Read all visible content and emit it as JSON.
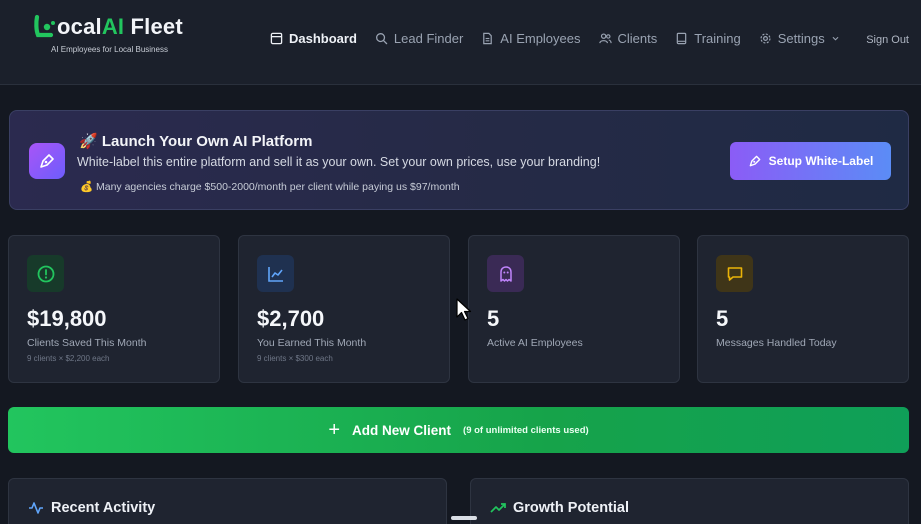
{
  "brand": {
    "name_prefix": "ocal",
    "name_ai": "AI",
    "name_suffix": " Fleet",
    "tagline": "AI Employees for Local Business",
    "accent": "#22c55e"
  },
  "nav": {
    "items": [
      {
        "label": "Dashboard",
        "icon": "layout-icon",
        "active": true
      },
      {
        "label": "Lead Finder",
        "icon": "search-icon"
      },
      {
        "label": "AI Employees",
        "icon": "file-icon"
      },
      {
        "label": "Clients",
        "icon": "users-icon"
      },
      {
        "label": "Training",
        "icon": "book-icon"
      },
      {
        "label": "Settings",
        "icon": "gear-icon"
      }
    ],
    "sign_out": "Sign Out"
  },
  "banner": {
    "title": "🚀 Launch Your Own AI Platform",
    "description": "White-label this entire platform and sell it as your own. Set your own prices, use your branding!",
    "note": "💰 Many agencies charge $500-2000/month per client while paying us $97/month",
    "button": "Setup White-Label"
  },
  "stats": [
    {
      "value": "$19,800",
      "label": "Clients Saved This Month",
      "sub": "9 clients × $2,200 each",
      "icon": "alert-circle-icon",
      "color": "#22c55e"
    },
    {
      "value": "$2,700",
      "label": "You Earned This Month",
      "sub": "9 clients × $300 each",
      "icon": "chart-line-icon",
      "color": "#60a5fa"
    },
    {
      "value": "5",
      "label": "Active AI Employees",
      "sub": "",
      "icon": "ghost-icon",
      "color": "#c084fc"
    },
    {
      "value": "5",
      "label": "Messages Handled Today",
      "sub": "",
      "icon": "message-icon",
      "color": "#eab308"
    }
  ],
  "add_client": {
    "label": "Add New Client",
    "meta": "(9 of unlimited clients used)"
  },
  "panels": {
    "recent_activity": "Recent Activity",
    "growth_potential": "Growth Potential"
  }
}
